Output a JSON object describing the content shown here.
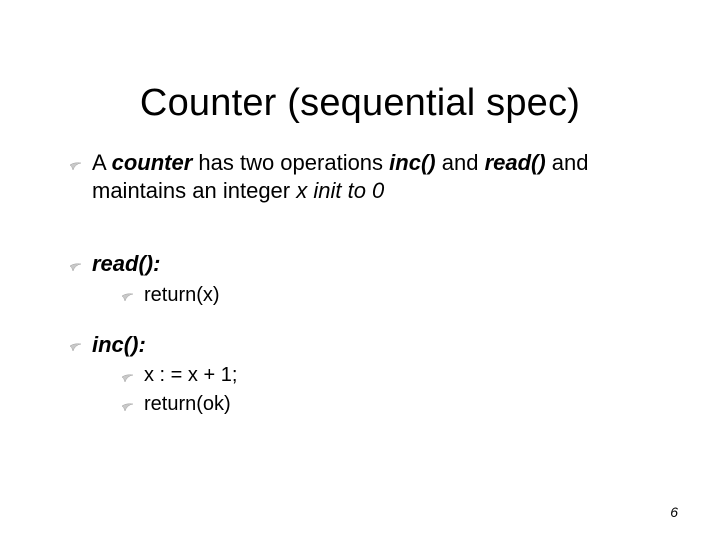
{
  "title": "Counter (sequential spec)",
  "items": {
    "intro": {
      "t1": "A ",
      "t2": "counter",
      "t3": " has two operations ",
      "t4": "inc()",
      "t5": " and ",
      "t6": "read()",
      "t7": " and maintains an integer ",
      "t8": "x init to 0"
    },
    "read_label": "read():",
    "read_body": "return(x)",
    "inc_label": "inc():",
    "inc_body1": "x : = x + 1;",
    "inc_body2": "return(ok)"
  },
  "page_number": "6"
}
